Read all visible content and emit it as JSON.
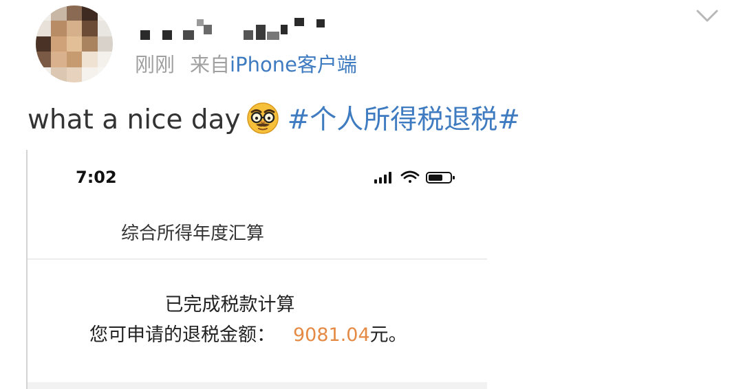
{
  "post": {
    "meta": {
      "time": "刚刚",
      "source_prefix": "来自",
      "device": "iPhone客户端"
    },
    "text": "what a nice day",
    "emoji_icon": "disguise-glasses-emoji",
    "hashtag": "#个人所得税退税#"
  },
  "screenshot": {
    "status_time": "7:02",
    "title": "综合所得年度汇算",
    "done_text": "已完成税款计算",
    "refund_label": "您可申请的退税金额：",
    "refund_amount": "9081.04",
    "refund_unit": "元。"
  },
  "colors": {
    "link_blue": "#3f7bc0",
    "amount_orange": "#e58a44",
    "meta_gray": "#a0a0a0"
  }
}
